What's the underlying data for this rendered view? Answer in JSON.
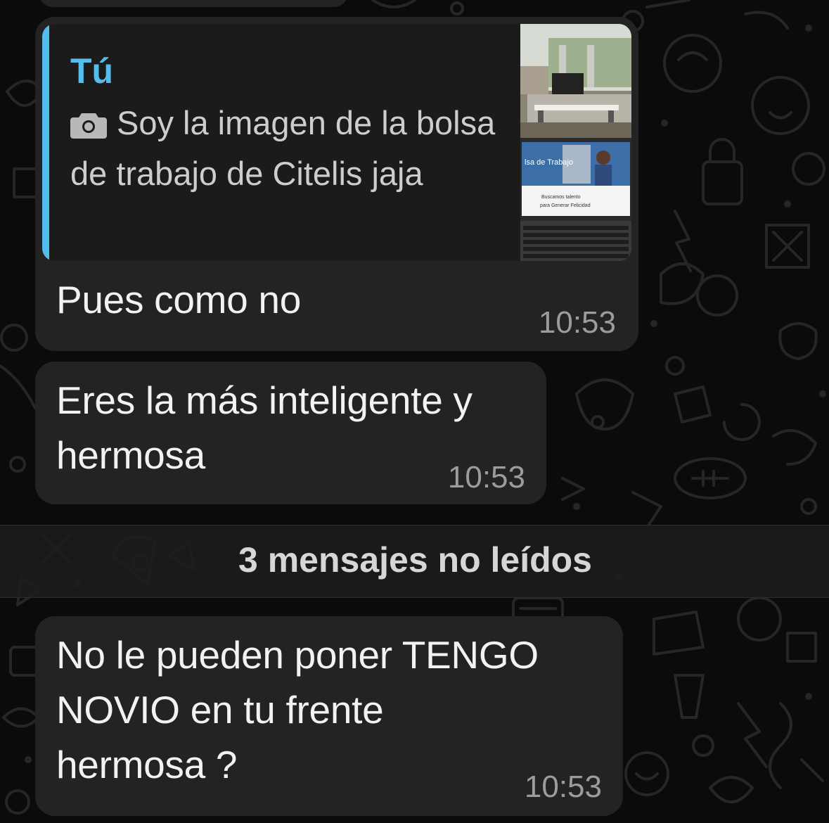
{
  "messages": [
    {
      "quote": {
        "author": "Tú",
        "icon": "camera-icon",
        "text": "Soy la imagen de la bolsa de trabajo de Citelis jaja"
      },
      "text": "Pues como no",
      "time": "10:53"
    },
    {
      "text": "Eres la más inteligente y\nhermosa",
      "time": "10:53"
    },
    {
      "text": "No le pueden poner TENGO\nNOVIO en tu frente\nhermosa ?",
      "time": "10:53"
    }
  ],
  "unread_divider": "3 mensajes no leídos",
  "colors": {
    "bubble": "#232323",
    "quote_accent": "#53bdeb",
    "background": "#0b0b0b"
  }
}
